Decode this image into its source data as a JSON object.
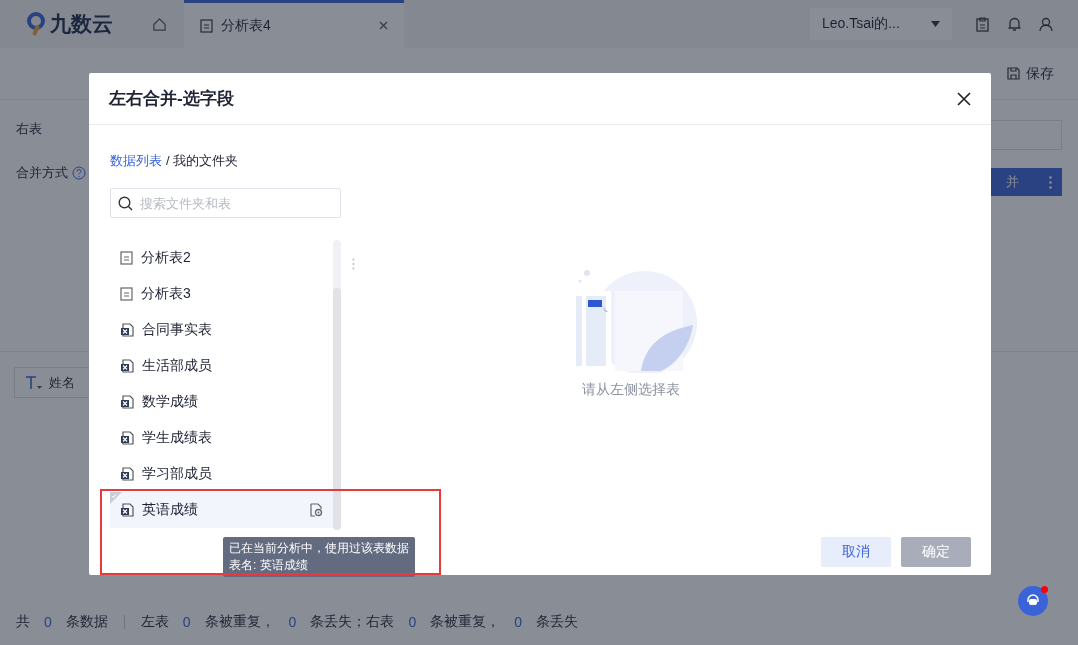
{
  "header": {
    "logo": "九数云",
    "tabs": [
      {
        "label": "分析表4",
        "selected": true
      }
    ],
    "account": "Leo.Tsai的..."
  },
  "toolbar": {
    "save": "保存"
  },
  "background": {
    "right_table": "右表",
    "merge_mode": "合并方式",
    "merge_button": "并",
    "field_chip": "姓名"
  },
  "status_bar": [
    [
      {
        "kind": "label",
        "text": "共"
      },
      {
        "kind": "count",
        "text": "0"
      },
      {
        "kind": "label",
        "text": "条数据"
      }
    ],
    [
      {
        "kind": "label",
        "text": "左表"
      },
      {
        "kind": "count",
        "text": "0"
      },
      {
        "kind": "label",
        "text": "条被重复，"
      },
      {
        "kind": "count",
        "text": "0"
      },
      {
        "kind": "label",
        "text": "条丢失；右表"
      },
      {
        "kind": "count",
        "text": "0"
      },
      {
        "kind": "label",
        "text": "条被重复，"
      },
      {
        "kind": "count",
        "text": "0"
      },
      {
        "kind": "label",
        "text": "条丢失"
      }
    ]
  ],
  "dialog": {
    "title": "左右合并-选字段",
    "breadcrumb": [
      {
        "kind": "link",
        "text": "数据列表"
      },
      {
        "kind": "current",
        "text": "/ 我的文件夹"
      }
    ],
    "search": {
      "placeholder": "搜索文件夹和表"
    },
    "items": [
      {
        "name": "分析表2",
        "kind": "analysis",
        "selected": false,
        "used": false
      },
      {
        "name": "分析表3",
        "kind": "analysis",
        "selected": false,
        "used": false
      },
      {
        "name": "合同事实表",
        "kind": "excel",
        "selected": false,
        "used": false
      },
      {
        "name": "生活部成员",
        "kind": "excel",
        "selected": false,
        "used": false
      },
      {
        "name": "数学成绩",
        "kind": "excel",
        "selected": false,
        "used": false
      },
      {
        "name": "学生成绩表",
        "kind": "excel",
        "selected": false,
        "used": false
      },
      {
        "name": "学习部成员",
        "kind": "excel",
        "selected": false,
        "used": false
      },
      {
        "name": "英语成绩",
        "kind": "excel",
        "selected": true,
        "used": true
      }
    ],
    "tooltip": [
      "已在当前分析中，使用过该表数据",
      "表名: 英语成绩"
    ],
    "empty_text": "请从左侧选择表",
    "buttons": [
      {
        "label": "取消",
        "kind": "secondary",
        "disabled": false
      },
      {
        "label": "确定",
        "kind": "primary",
        "disabled": true
      }
    ]
  }
}
